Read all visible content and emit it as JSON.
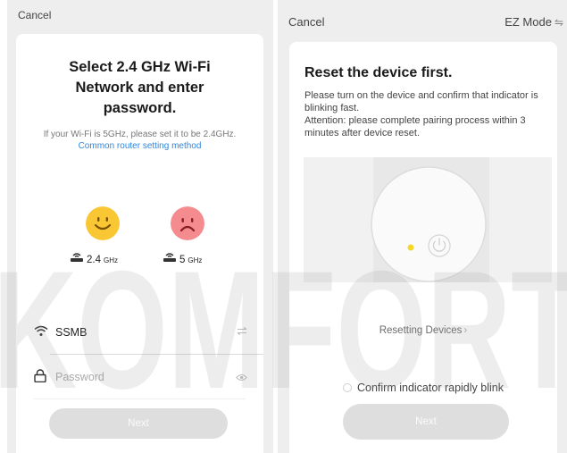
{
  "wifi_screen": {
    "cancel_label": "Cancel",
    "title_line1": "Select 2.4 GHz Wi-Fi",
    "title_line2": "Network and enter",
    "title_line3": "password.",
    "hint_text": "If your Wi-Fi is 5GHz, please set it to be 2.4GHz.",
    "hint_link": "Common router setting method",
    "band_ok_value": "2.4",
    "band_ok_unit": "GHz",
    "band_bad_value": "5",
    "band_bad_unit": "GHz",
    "ssid_value": "SSMB",
    "password_placeholder": "Password",
    "next_label": "Next",
    "icons": {
      "ok": "smiling-face-icon",
      "bad": "frowning-face-icon",
      "router": "router-icon",
      "wifi": "wifi-icon",
      "lock": "lock-icon",
      "switch": "switch-network-icon",
      "eye": "eye-icon"
    },
    "colors": {
      "ok": "#f9c634",
      "bad": "#f38b8f",
      "link": "#2e86de"
    }
  },
  "reset_screen": {
    "cancel_label": "Cancel",
    "mode_label": "EZ Mode",
    "title": "Reset the device first.",
    "description_line1": "Please turn on the device and confirm that indicator is blinking fast.",
    "description_line2": "Attention: please complete pairing process within 3 minutes after device reset.",
    "resetting_link": "Resetting Devices",
    "confirm_label": "Confirm indicator rapidly blink",
    "next_label": "Next",
    "icons": {
      "indicator": "indicator-light-icon",
      "power": "power-icon",
      "chevron": "chevron-right-icon"
    },
    "colors": {
      "indicator": "#f5d72a"
    }
  },
  "watermark": {
    "text": "KOMFORT"
  }
}
